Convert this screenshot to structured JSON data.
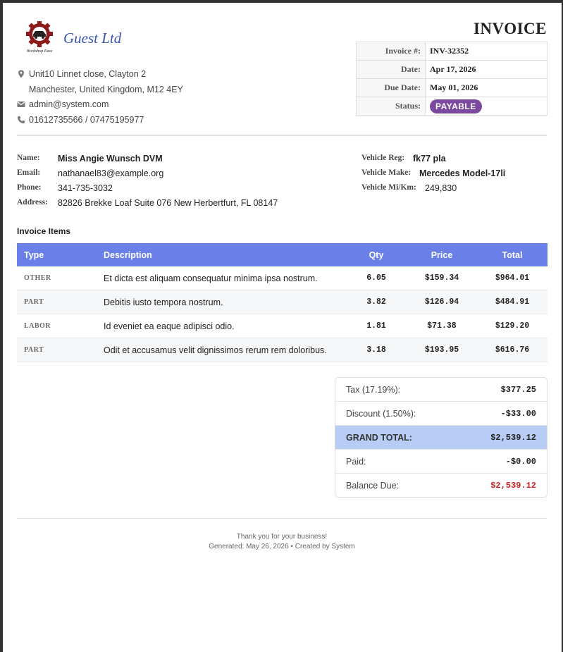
{
  "company": {
    "name": "Guest Ltd",
    "logo_text": "Workshop Ease",
    "address_line1": "Unit10 Linnet close, Clayton 2",
    "address_line2": "Manchester, United Kingdom, M12 4EY",
    "email": "admin@system.com",
    "phone": "01612735566 / 07475195977"
  },
  "invoice": {
    "title": "INVOICE",
    "meta": [
      {
        "key": "Invoice #:",
        "value": "INV-32352"
      },
      {
        "key": "Date:",
        "value": "Apr 17, 2026"
      },
      {
        "key": "Due Date:",
        "value": "May 01, 2026"
      },
      {
        "key": "Status:",
        "value": "PAYABLE"
      }
    ],
    "status_color": "#7b4aa0"
  },
  "customer": {
    "name_label": "Name:",
    "name": "Miss Angie Wunsch DVM",
    "email_label": "Email:",
    "email": "nathanael83@example.org",
    "phone_label": "Phone:",
    "phone": "341-735-3032",
    "address_label": "Address:",
    "address": "82826 Brekke Loaf Suite 076 New Herbertfurt, FL 08147"
  },
  "vehicle": {
    "reg_label": "Vehicle Reg:",
    "reg": "fk77 pla",
    "make_label": "Vehicle Make:",
    "make": "Mercedes Model-17li",
    "mileage_label": "Vehicle Mi/Km:",
    "mileage": "249,830"
  },
  "items": {
    "title": "Invoice Items",
    "headers": [
      "Type",
      "Description",
      "Qty",
      "Price",
      "Total"
    ],
    "header_color": "#6a7fe8",
    "rows": [
      {
        "type": "OTHER",
        "description": "Et dicta est aliquam consequatur minima ipsa nostrum.",
        "qty": "6.05",
        "price": "$159.34",
        "total": "$964.01"
      },
      {
        "type": "PART",
        "description": "Debitis iusto tempora nostrum.",
        "qty": "3.82",
        "price": "$126.94",
        "total": "$484.91"
      },
      {
        "type": "LABOR",
        "description": "Id eveniet ea eaque adipisci odio.",
        "qty": "1.81",
        "price": "$71.38",
        "total": "$129.20"
      },
      {
        "type": "PART",
        "description": "Odit et accusamus velit dignissimos rerum rem doloribus.",
        "qty": "3.18",
        "price": "$193.95",
        "total": "$616.76"
      }
    ]
  },
  "totals": {
    "tax_label": "Tax (17.19%):",
    "tax": "$377.25",
    "discount_label": "Discount (1.50%):",
    "discount": "-$33.00",
    "grand_label": "GRAND TOTAL:",
    "grand": "$2,539.12",
    "paid_label": "Paid:",
    "paid": "-$0.00",
    "balance_label": "Balance Due:",
    "balance": "$2,539.12"
  },
  "footer": {
    "thanks": "Thank you for your business!",
    "generated": "Generated: May 26, 2026 • Created by System"
  }
}
